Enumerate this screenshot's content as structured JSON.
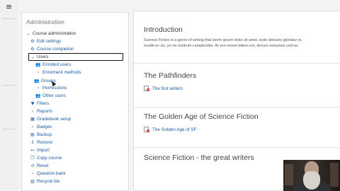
{
  "admin": {
    "title": "Administration",
    "items": [
      {
        "icon": "chevron-down-icon",
        "glyph": "⌄",
        "label": "Course administration"
      },
      {
        "icon": "gear-icon",
        "glyph": "⚙",
        "label": "Edit settings"
      },
      {
        "icon": "gear-icon",
        "glyph": "⚙",
        "label": "Course completion"
      },
      {
        "icon": "chevron-down-icon",
        "glyph": "⌄",
        "label": "Users"
      },
      {
        "icon": "users-icon",
        "glyph": "👥",
        "label": "Enrolled users"
      },
      {
        "icon": "chevron-right-icon",
        "glyph": "›",
        "label": "Enrolment methods"
      },
      {
        "icon": "users-icon",
        "glyph": "👥",
        "label": "Groups"
      },
      {
        "icon": "chevron-right-icon",
        "glyph": "›",
        "label": "Permissions"
      },
      {
        "icon": "users-icon",
        "glyph": "👥",
        "label": "Other users"
      },
      {
        "icon": "filter-icon",
        "glyph": "▼",
        "label": "Filters"
      },
      {
        "icon": "chevron-right-icon",
        "glyph": "›",
        "label": "Reports"
      },
      {
        "icon": "gradebook-icon",
        "glyph": "▦",
        "label": "Gradebook setup"
      },
      {
        "icon": "chevron-right-icon",
        "glyph": "›",
        "label": "Badges"
      },
      {
        "icon": "backup-icon",
        "glyph": "▤",
        "label": "Backup"
      },
      {
        "icon": "restore-icon",
        "glyph": "↥",
        "label": "Restore"
      },
      {
        "icon": "import-icon",
        "glyph": "↤",
        "label": "Import"
      },
      {
        "icon": "copy-icon",
        "glyph": "❐",
        "label": "Copy course"
      },
      {
        "icon": "reset-icon",
        "glyph": "↺",
        "label": "Reset"
      },
      {
        "icon": "chevron-right-icon",
        "glyph": "›",
        "label": "Question bank"
      },
      {
        "icon": "trash-icon",
        "glyph": "▥",
        "label": "Recycle bin"
      }
    ]
  },
  "main": {
    "sections": [
      {
        "title": "Introduction",
        "summary": "Science Fiction is a genre of writing that lorem ipsum dolor sit amet, iusto detracto gloriatur ei,",
        "summary2": "eruditi ex vix, pri ne nostrum complectitur. At ven movet bitteni est, decore nonumes sed no."
      },
      {
        "title": "The Pathfinders",
        "activity": "The first writers"
      },
      {
        "title": "The Golden Age of Science Fiction",
        "activity": "The Golden Age of SF"
      },
      {
        "title": "Science Fiction - the great writers"
      }
    ]
  }
}
